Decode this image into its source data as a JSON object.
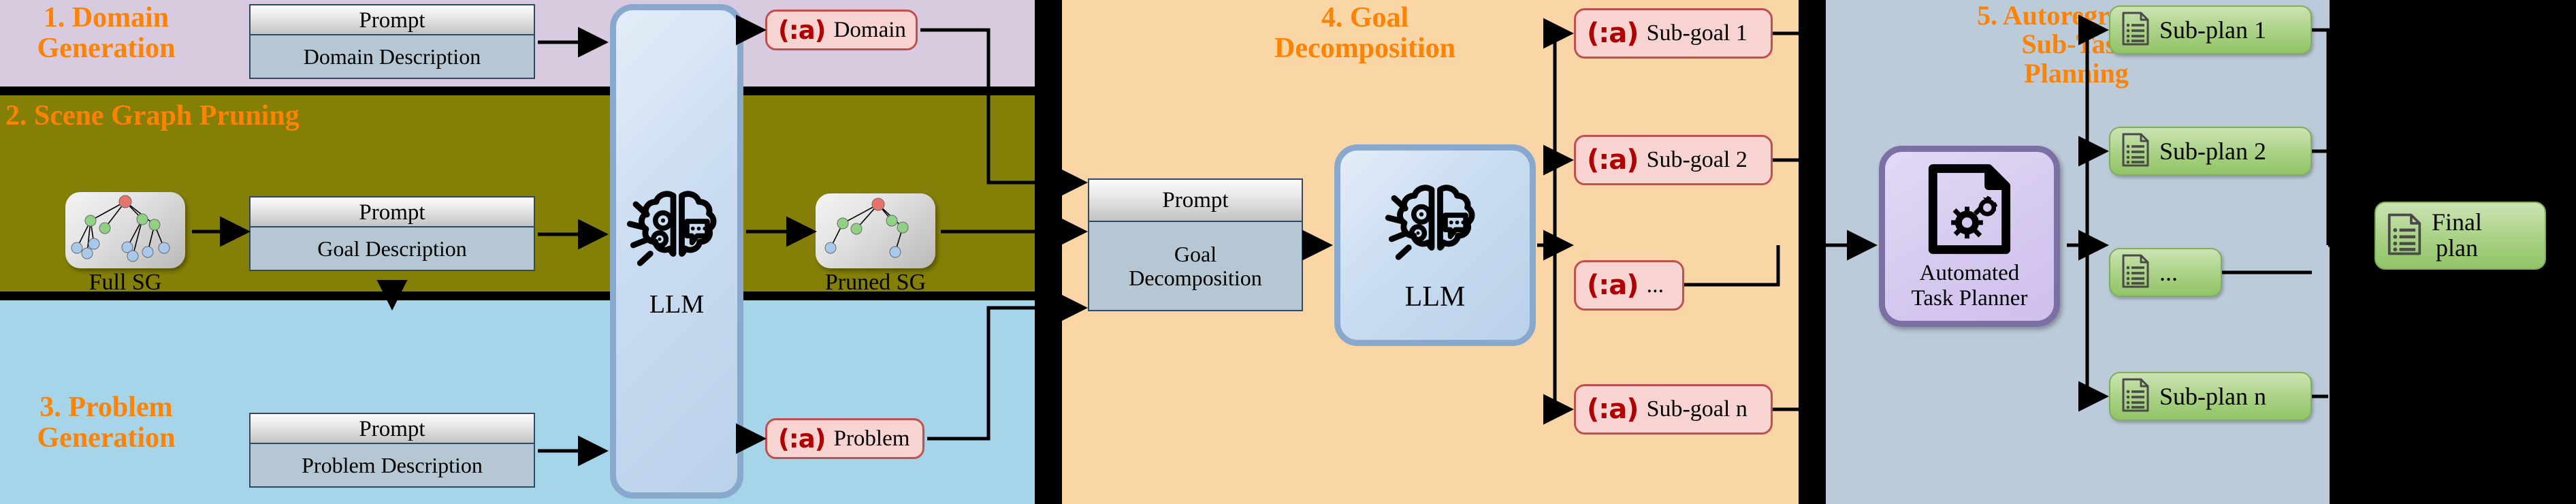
{
  "sections": {
    "s1": {
      "title": "1. Domain\nGeneration"
    },
    "s2": {
      "title": "2. Scene Graph Pruning"
    },
    "s3": {
      "title": "3. Problem\nGeneration"
    },
    "s4": {
      "title": "4. Goal\nDecomposition"
    },
    "s5": {
      "title": "5. Autoregressive\nSub-Task\nPlanning"
    }
  },
  "prompts": {
    "domain": {
      "head": "Prompt",
      "body": "Domain Description"
    },
    "goal_sg": {
      "head": "Prompt",
      "body": "Goal Description"
    },
    "problem": {
      "head": "Prompt",
      "body": "Problem Description"
    },
    "decomp": {
      "head": "Prompt",
      "body": "Goal\nDecomposition"
    }
  },
  "llm": {
    "label": "LLM",
    "icon": "brain-icon"
  },
  "planner": {
    "label": "Automated\nTask Planner",
    "icon": "document-gears-icon"
  },
  "pddl_token": "(:a)",
  "outputs": {
    "domain": "Domain",
    "problem": "Problem"
  },
  "scene_graphs": {
    "full": {
      "caption": "Full SG"
    },
    "pruned": {
      "caption": "Pruned SG"
    }
  },
  "subgoals": [
    {
      "label": "Sub-goal 1"
    },
    {
      "label": "Sub-goal 2"
    },
    {
      "label": "..."
    },
    {
      "label": "Sub-goal n"
    }
  ],
  "subplans": [
    {
      "label": "Sub-plan 1"
    },
    {
      "label": "Sub-plan 2"
    },
    {
      "label": "..."
    },
    {
      "label": "Sub-plan n"
    }
  ],
  "final_plan": {
    "label": "Final\nplan",
    "icon": "document-list-icon"
  },
  "colors": {
    "accent_title": "#ff8200",
    "band_domain": "#d8cbdf",
    "band_scene": "#837f07",
    "band_problem": "#a6d4e8",
    "panel_goal": "#fad6a7",
    "panel_subtask": "#bccbd9",
    "pddl_red": "#b00000",
    "chip_pink": "#f7d3d2",
    "chip_green": "#a9d184",
    "llm_blue": "#c9dcf1",
    "planner_purple": "#d6c9ef"
  }
}
